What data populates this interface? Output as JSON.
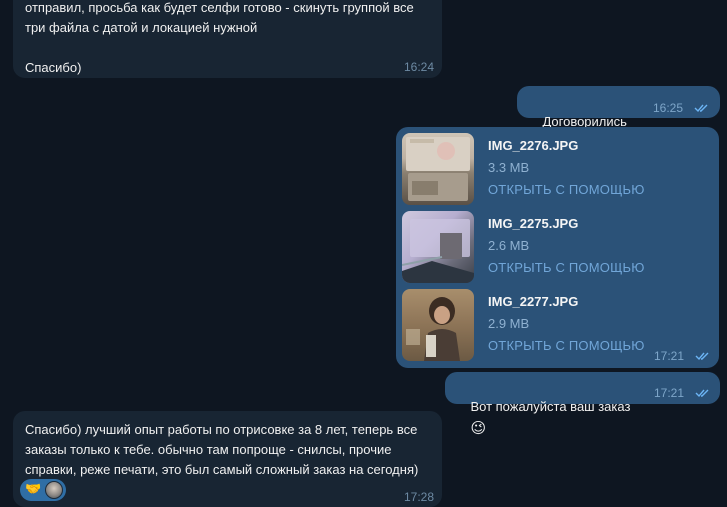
{
  "messages": {
    "m1": {
      "text": "отправил, просьба как будет селфи готово - скинуть группой все\nтри файла с датой и локацией нужной\n\nСпасибо)",
      "time": "16:24"
    },
    "m2": {
      "text": "Договорились",
      "emoji": "🤝",
      "time": "16:25"
    },
    "m3": {
      "files": [
        {
          "name": "IMG_2276.JPG",
          "size": "3.3 MB",
          "action": "ОТКРЫТЬ С ПОМОЩЬЮ"
        },
        {
          "name": "IMG_2275.JPG",
          "size": "2.6 MB",
          "action": "ОТКРЫТЬ С ПОМОЩЬЮ"
        },
        {
          "name": "IMG_2277.JPG",
          "size": "2.9 MB",
          "action": "ОТКРЫТЬ С ПОМОЩЬЮ"
        }
      ],
      "time": "17:21"
    },
    "m4": {
      "text": "Вот пожалуйста ваш заказ",
      "emoji": "😉",
      "time": "17:21"
    },
    "m5": {
      "text": "Спасибо) лучший опыт работы по отрисовке за 8 лет, теперь все\nзаказы только к тебе. обычно там попроще - снилсы, прочие\nсправки, реже печати, это был самый сложный заказ на сегодня)",
      "reaction_emoji": "🤝",
      "time": "17:28"
    }
  },
  "colors": {
    "background": "#0e1621",
    "incoming_bubble": "#182533",
    "outgoing_bubble": "#2b5278",
    "link": "#71a6d8",
    "read_ticks": "#6cb5f5"
  },
  "icons": {
    "read_status": "double-check-icon",
    "reaction_avatar": "avatar"
  }
}
